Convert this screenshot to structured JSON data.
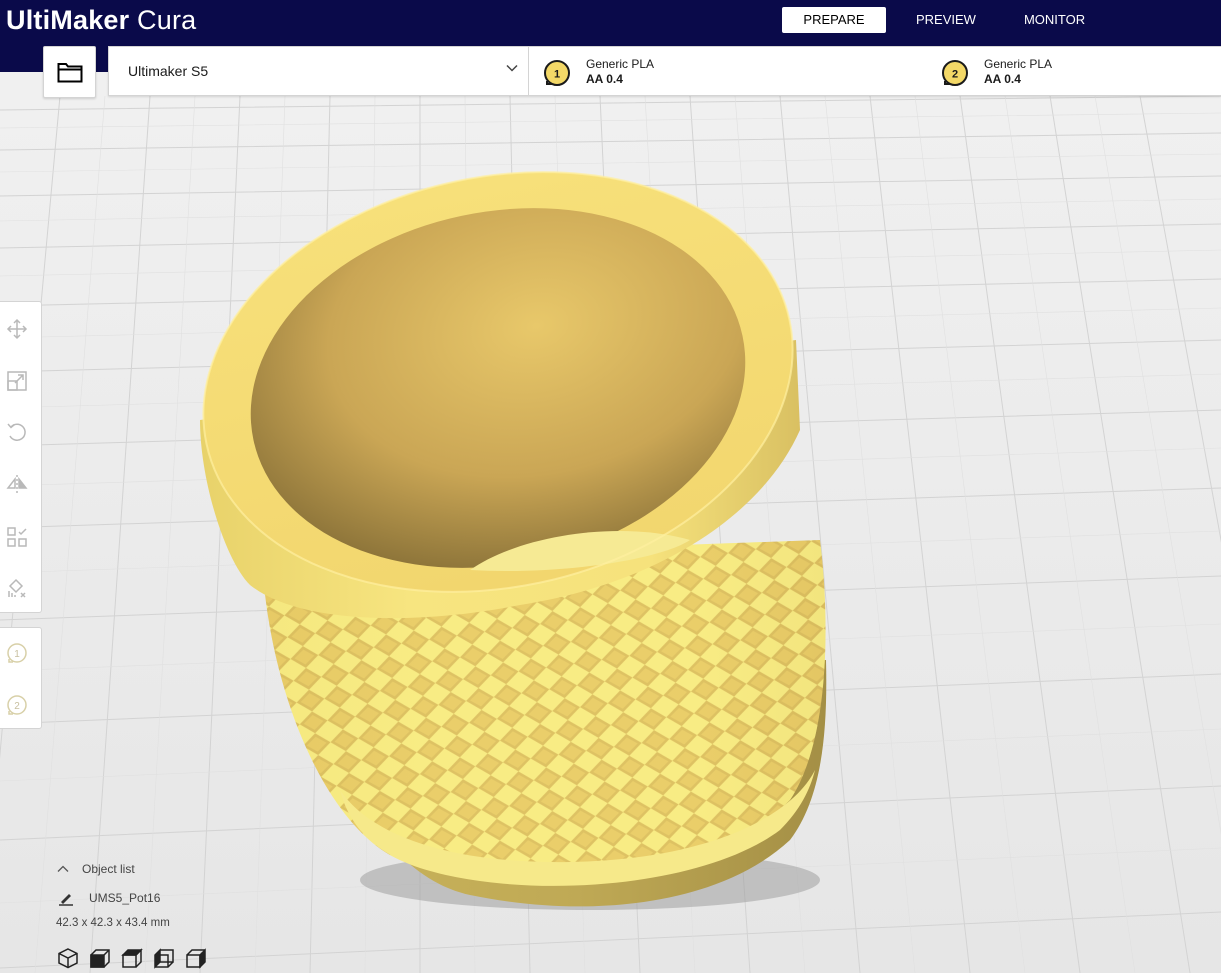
{
  "app": {
    "brand": "UltiMaker",
    "product": "Cura"
  },
  "stages": [
    {
      "label": "PREPARE",
      "active": true
    },
    {
      "label": "PREVIEW",
      "active": false
    },
    {
      "label": "MONITOR",
      "active": false
    }
  ],
  "printer": {
    "name": "Ultimaker S5"
  },
  "extruders": [
    {
      "number": "1",
      "material": "Generic PLA",
      "core": "AA 0.4"
    },
    {
      "number": "2",
      "material": "Generic PLA",
      "core": "AA 0.4"
    }
  ],
  "tools": [
    {
      "name": "move-icon"
    },
    {
      "name": "scale-icon"
    },
    {
      "name": "rotate-icon"
    },
    {
      "name": "mirror-icon"
    },
    {
      "name": "per-model-settings-icon"
    },
    {
      "name": "support-blocker-icon"
    }
  ],
  "object_list": {
    "title": "Object list",
    "item_name": "UMS5_Pot16",
    "dimensions": "42.3 x 42.3 x 43.4 mm"
  },
  "view_buttons": [
    "3d-view-icon",
    "front-view-icon",
    "top-view-icon",
    "left-view-icon",
    "right-view-icon"
  ],
  "colors": {
    "header_bg": "#0a0a4a",
    "model_yellow": "#f5e27a",
    "extruder_badge": "#f3d867"
  }
}
